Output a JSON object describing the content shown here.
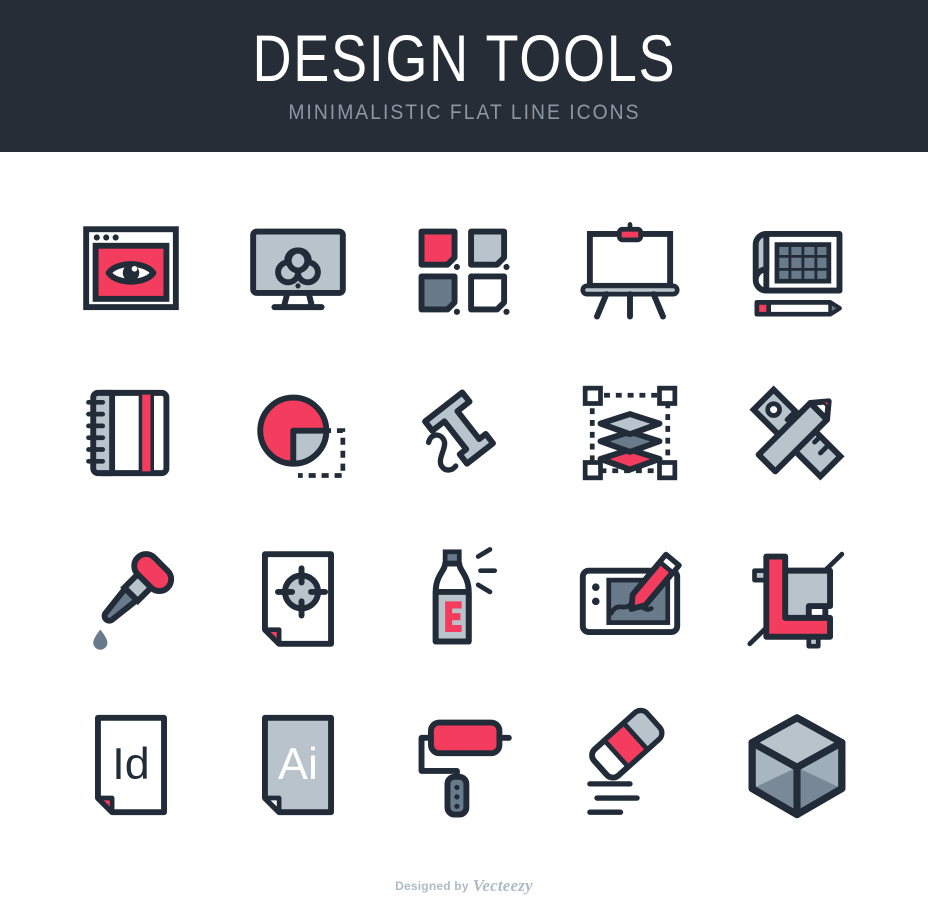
{
  "header": {
    "title": "DESIGN TOOLS",
    "subtitle": "MINIMALISTIC FLAT LINE ICONS",
    "background_color": "#262D36",
    "title_color": "#FFFFFF",
    "subtitle_color": "#8C98A4"
  },
  "palette": {
    "stroke": "#222B38",
    "red": "#F43D5E",
    "gray_light": "#B8C3CC",
    "gray_slate": "#697A8A",
    "white": "#FFFFFF",
    "page_background": "#FFFFFF"
  },
  "grid": {
    "columns": 5,
    "rows": 4,
    "count": 20
  },
  "icons": [
    {
      "index": 1,
      "name": "browser-eye-icon",
      "label": "Preview",
      "row": 1,
      "col": 1,
      "accent": "#F43D5E"
    },
    {
      "index": 2,
      "name": "monitor-infinity-icon",
      "label": "Infinite Canvas",
      "row": 1,
      "col": 2,
      "accent": "#B8C3CC"
    },
    {
      "index": 3,
      "name": "color-swatches-icon",
      "label": "Color Swatches",
      "row": 1,
      "col": 3,
      "accent": "#F43D5E"
    },
    {
      "index": 4,
      "name": "easel-icon",
      "label": "Easel",
      "row": 1,
      "col": 4,
      "accent": "#F43D5E"
    },
    {
      "index": 5,
      "name": "blueprint-pencil-icon",
      "label": "Blueprint",
      "row": 1,
      "col": 5,
      "accent": "#F43D5E"
    },
    {
      "index": 6,
      "name": "sketchbook-icon",
      "label": "Sketchbook",
      "row": 2,
      "col": 1,
      "accent": "#F43D5E"
    },
    {
      "index": 7,
      "name": "pie-chart-icon",
      "label": "Pie Chart",
      "row": 2,
      "col": 2,
      "accent": "#F43D5E"
    },
    {
      "index": 8,
      "name": "type-tool-icon",
      "label": "Type Tool",
      "row": 2,
      "col": 3,
      "accent": "#B8C3CC"
    },
    {
      "index": 9,
      "name": "layers-icon",
      "label": "Layers",
      "row": 2,
      "col": 4,
      "accent": "#F43D5E"
    },
    {
      "index": 10,
      "name": "ruler-pencil-icon",
      "label": "Ruler and Pencil",
      "row": 2,
      "col": 5,
      "accent": "#F43D5E"
    },
    {
      "index": 11,
      "name": "eyedropper-icon",
      "label": "Eyedropper",
      "row": 3,
      "col": 1,
      "accent": "#F43D5E"
    },
    {
      "index": 12,
      "name": "target-document-icon",
      "label": "Target Document",
      "row": 3,
      "col": 2,
      "accent": "#F43D5E"
    },
    {
      "index": 13,
      "name": "spray-can-icon",
      "label": "Spray Can",
      "row": 3,
      "col": 3,
      "accent": "#F43D5E"
    },
    {
      "index": 14,
      "name": "graphics-tablet-icon",
      "label": "Graphics Tablet",
      "row": 3,
      "col": 4,
      "accent": "#F43D5E"
    },
    {
      "index": 15,
      "name": "crop-tool-icon",
      "label": "Crop Tool",
      "row": 3,
      "col": 5,
      "accent": "#F43D5E"
    },
    {
      "index": 16,
      "name": "indesign-file-icon",
      "label": "Id",
      "row": 4,
      "col": 1,
      "accent": "#F43D5E"
    },
    {
      "index": 17,
      "name": "illustrator-file-icon",
      "label": "Ai",
      "row": 4,
      "col": 2,
      "accent": "#B8C3CC"
    },
    {
      "index": 18,
      "name": "paint-roller-icon",
      "label": "Paint Roller",
      "row": 4,
      "col": 3,
      "accent": "#F43D5E"
    },
    {
      "index": 19,
      "name": "eraser-icon",
      "label": "Eraser",
      "row": 4,
      "col": 4,
      "accent": "#F43D5E"
    },
    {
      "index": 20,
      "name": "cube-3d-icon",
      "label": "3D Cube",
      "row": 4,
      "col": 5,
      "accent": "#B8C3CC"
    }
  ],
  "file_badges": {
    "indesign": "Id",
    "illustrator": "Ai"
  },
  "footer": {
    "designed_by": "Designed by",
    "brand": "Vecteezy",
    "color": "#AEBBC6"
  }
}
